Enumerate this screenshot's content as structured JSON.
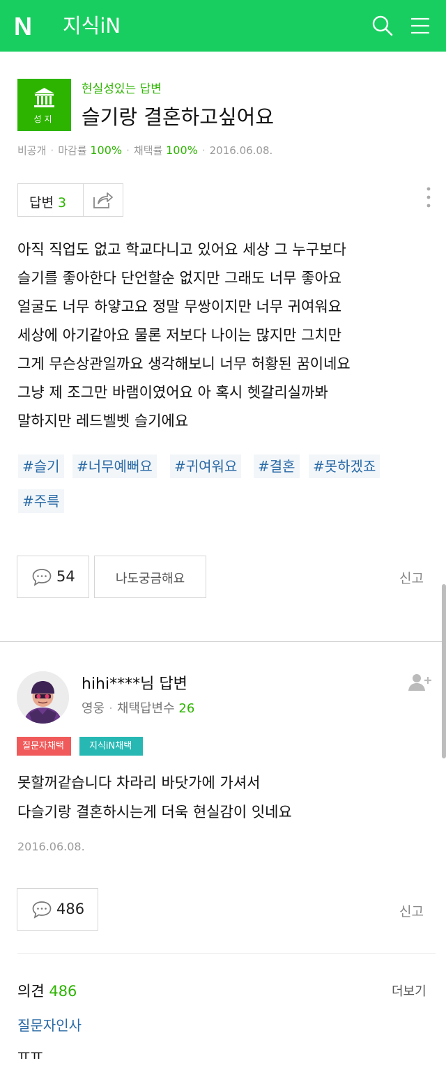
{
  "header": {
    "logo": "N",
    "brand": "지식iN",
    "icons": [
      "search-icon",
      "menu-icon"
    ],
    "color": "#19ce60"
  },
  "question": {
    "badge_label": "성지",
    "category": "현실성있는 답변",
    "title": "슬기랑 결혼하고싶어요",
    "meta": {
      "visibility": "비공개",
      "close_rate_label": "마감률",
      "close_rate": "100%",
      "adopt_rate_label": "채택률",
      "adopt_rate": "100%",
      "date": "2016.06.08."
    },
    "answer_tab_label": "답변",
    "answer_count": "3",
    "body_lines": [
      "아직 직업도 없고 학교다니고 있어요 세상 그 누구보다",
      "슬기를 좋아한다 단언할순 없지만 그래도 너무 좋아요",
      "얼굴도 너무 하얗고요 정말 무쌍이지만 너무 귀여워요",
      "세상에 아기같아요 물론 저보다 나이는 많지만 그치만",
      "그게 무슨상관일까요 생각해보니 너무 허황된 꿈이네요",
      "그냥 제 조그만 바램이였어요 아 혹시 헷갈리실까봐",
      "말하지만 레드벨벳 슬기에요"
    ],
    "tags": [
      "#슬기",
      "#너무예뻐요",
      "#귀여워요",
      "#결혼",
      "#못하겠죠",
      "#주륵"
    ],
    "comment_count": "54",
    "curious_label": "나도궁금해요",
    "report_label": "신고"
  },
  "answer": {
    "user": "hihi****님 답변",
    "level": "영웅",
    "adopted_label": "채택답변수",
    "adopted_count": "26",
    "chips": [
      "질문자채택",
      "지식iN채택"
    ],
    "body_lines": [
      "못할꺼같습니다 차라리 바닷가에 가셔서",
      "다슬기랑 결혼하시는게 더욱 현실감이 잇네요"
    ],
    "date": "2016.06.08.",
    "comment_count": "486",
    "report_label": "신고"
  },
  "opinion": {
    "label": "의견",
    "count": "486",
    "more_label": "더보기",
    "greeting_label": "질문자인사",
    "greeting_text": "ㅠㅠ"
  },
  "colors": {
    "green": "#2db400",
    "tag_blue": "#2a6aa6",
    "chip_red": "#f05a5a",
    "chip_teal": "#27b8b4"
  }
}
